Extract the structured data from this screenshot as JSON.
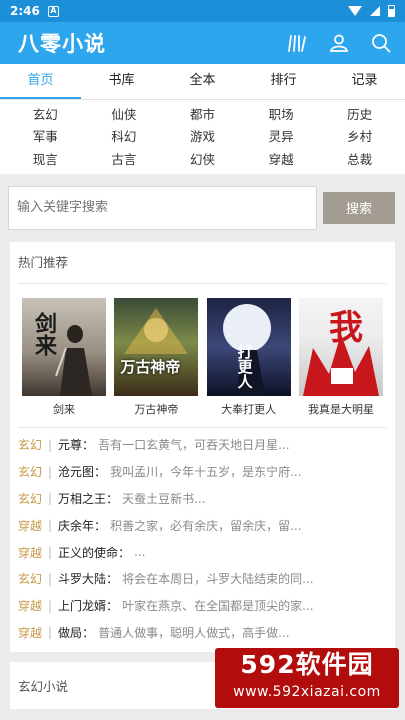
{
  "status_bar": {
    "time": "2:46",
    "notification_letter": "A"
  },
  "app": {
    "title": "八零小说"
  },
  "tabs": [
    {
      "label": "首页"
    },
    {
      "label": "书库"
    },
    {
      "label": "全本"
    },
    {
      "label": "排行"
    },
    {
      "label": "记录"
    }
  ],
  "genres": [
    [
      "玄幻",
      "仙侠",
      "都市",
      "职场",
      "历史"
    ],
    [
      "军事",
      "科幻",
      "游戏",
      "灵异",
      "乡村"
    ],
    [
      "现言",
      "古言",
      "幻侠",
      "穿越",
      "总裁"
    ]
  ],
  "search": {
    "placeholder": "输入关键字搜索",
    "button": "搜索"
  },
  "hot": {
    "title": "热门推荐",
    "covers": [
      {
        "name": "剑来",
        "art": "剑来"
      },
      {
        "name": "万古神帝",
        "art": "万古神帝"
      },
      {
        "name": "大奉打更人",
        "art": "打更人"
      },
      {
        "name": "我真是大明星",
        "art": "我"
      }
    ],
    "list": [
      {
        "cat": "玄幻",
        "title": "元尊",
        "desc": "吾有一口玄黄气，可吞天地日月星..."
      },
      {
        "cat": "玄幻",
        "title": "沧元图",
        "desc": "我叫孟川，今年十五岁，是东宁府..."
      },
      {
        "cat": "玄幻",
        "title": "万相之王",
        "desc": "天蚕土豆新书..."
      },
      {
        "cat": "穿越",
        "title": "庆余年",
        "desc": "积善之家，必有余庆，留余庆，留..."
      },
      {
        "cat": "穿越",
        "title": "正义的使命",
        "desc": "..."
      },
      {
        "cat": "玄幻",
        "title": "斗罗大陆",
        "desc": "将会在本周日，斗罗大陆结束的同..."
      },
      {
        "cat": "穿越",
        "title": "上门龙婿",
        "desc": "叶家在燕京、在全国都是顶尖的家..."
      },
      {
        "cat": "穿越",
        "title": "做局",
        "desc": "普通人做事，聪明人做式，高手做..."
      }
    ]
  },
  "section2": {
    "title": "玄幻小说"
  },
  "watermark": {
    "main": "592软件园",
    "url": "www.592xiazai.com"
  },
  "colors": {
    "primary": "#2da6ee",
    "category": "#c79a47",
    "search_button": "#a39c93",
    "watermark": "#b20c0c"
  }
}
